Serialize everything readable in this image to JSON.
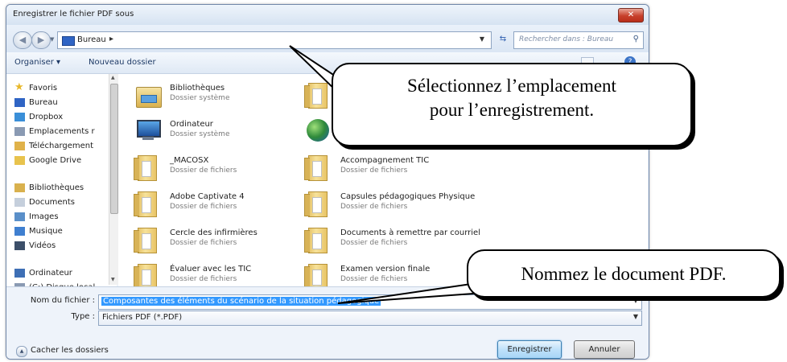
{
  "window": {
    "title": "Enregistrer le fichier PDF sous",
    "close_label": "✕"
  },
  "address": {
    "crumb": "Bureau",
    "arrow": "▸",
    "search_placeholder": "Rechercher dans : Bureau"
  },
  "toolbar": {
    "organize": "Organiser ▾",
    "new_folder": "Nouveau dossier"
  },
  "sidebar": {
    "items": [
      {
        "label": "Favoris",
        "icon": "star-icon",
        "color": "#e8b82a"
      },
      {
        "label": "Bureau",
        "icon": "desktop-icon",
        "color": "#2f64c4"
      },
      {
        "label": "Dropbox",
        "icon": "dropbox-icon",
        "color": "#3a8fd8"
      },
      {
        "label": "Emplacements r",
        "icon": "recent-places-icon",
        "color": "#8a9ab3"
      },
      {
        "label": "Téléchargement",
        "icon": "download-folder-icon",
        "color": "#e0b24a"
      },
      {
        "label": "Google Drive",
        "icon": "google-drive-icon",
        "color": "#e8c34d"
      },
      {
        "label": "Bibliothèques",
        "icon": "libraries-icon",
        "color": "#d9b14e"
      },
      {
        "label": "Documents",
        "icon": "documents-icon",
        "color": "#c5cfdc"
      },
      {
        "label": "Images",
        "icon": "images-icon",
        "color": "#5a8fc9"
      },
      {
        "label": "Musique",
        "icon": "music-icon",
        "color": "#3f7fd0"
      },
      {
        "label": "Vidéos",
        "icon": "videos-icon",
        "color": "#3c4f69"
      },
      {
        "label": "Ordinateur",
        "icon": "computer-icon",
        "color": "#3e6fb5"
      },
      {
        "label": "(C:) Disque local",
        "icon": "drive-icon",
        "color": "#8a9ab3"
      }
    ]
  },
  "files": [
    {
      "name": "Bibliothèques",
      "type": "Dossier système",
      "icon": "libraries-folder-icon"
    },
    {
      "name": "",
      "type": "",
      "icon": "user-folder-icon"
    },
    {
      "name": "Ordinateur",
      "type": "Dossier système",
      "icon": "computer-icon"
    },
    {
      "name": "",
      "type": "Dossier sy",
      "icon": "network-globe-icon"
    },
    {
      "name": "_MACOSX",
      "type": "Dossier de fichiers",
      "icon": "folder-icon"
    },
    {
      "name": "Accompagnement TIC",
      "type": "Dossier de fichiers",
      "icon": "folder-icon"
    },
    {
      "name": "Adobe Captivate 4",
      "type": "Dossier de fichiers",
      "icon": "folder-icon"
    },
    {
      "name": "Capsules pédagogiques Physique",
      "type": "Dossier de fichiers",
      "icon": "folder-icon"
    },
    {
      "name": "Cercle des infirmières",
      "type": "Dossier de fichiers",
      "icon": "folder-icon"
    },
    {
      "name": "Documents à remettre par courriel",
      "type": "Dossier de fichiers",
      "icon": "folder-icon"
    },
    {
      "name": "Évaluer avec les TIC",
      "type": "Dossier de fichiers",
      "icon": "folder-icon"
    },
    {
      "name": "Examen version finale",
      "type": "Dossier de fichiers",
      "icon": "folder-icon"
    }
  ],
  "form": {
    "filename_label": "Nom du fichier :",
    "filename_value": "Composantes des éléments du scénario de la situation pédagogique",
    "type_label": "Type :",
    "type_value": "Fichiers PDF (*.PDF)"
  },
  "footer": {
    "hide_folders": "Cacher les dossiers",
    "save": "Enregistrer",
    "cancel": "Annuler"
  },
  "callouts": {
    "location_line1": "Sélectionnez l’emplacement",
    "location_line2": "pour l’enregistrement.",
    "name": "Nommez le document PDF."
  },
  "colors": {
    "accent": "#3399ff",
    "close": "#c7402b",
    "frame": "#6f86a8"
  }
}
